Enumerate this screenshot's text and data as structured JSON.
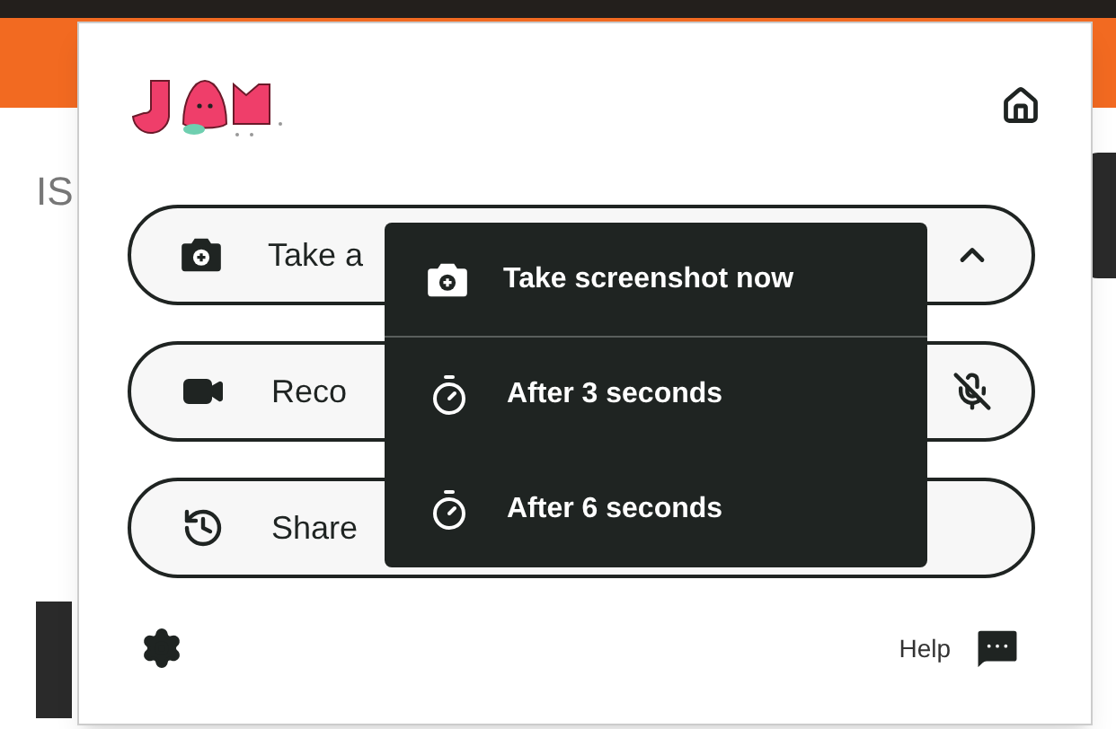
{
  "page": {
    "side_text": "IS"
  },
  "actions": [
    {
      "kind": "screenshot",
      "label": "Take a",
      "expanded": true
    },
    {
      "kind": "record",
      "label": "Reco",
      "mic_muted": true
    },
    {
      "kind": "history",
      "label": "Share"
    }
  ],
  "menu": [
    {
      "kind": "now",
      "label": "Take screenshot now"
    },
    {
      "kind": "timer",
      "label": "After 3 seconds"
    },
    {
      "kind": "timer",
      "label": "After 6 seconds"
    }
  ],
  "footer": {
    "help": "Help"
  }
}
